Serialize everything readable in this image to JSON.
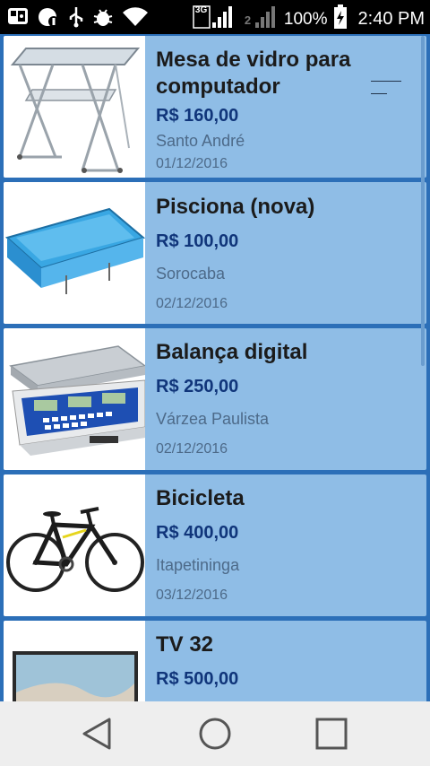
{
  "status_bar": {
    "network_label": "3G",
    "sim_label": "2",
    "battery": "100%",
    "time": "2:40 PM",
    "icons": [
      "whatsapp-icon",
      "notification-icon",
      "usb-icon",
      "bug-icon",
      "wifi-icon",
      "signal-icon",
      "signal-icon-2",
      "battery-charging-icon"
    ]
  },
  "listings": [
    {
      "title": "Mesa de vidro para computador",
      "price": "R$ 160,00",
      "city": "Santo André",
      "date": "01/12/2016",
      "image": "glass-desk"
    },
    {
      "title": "Pisciona (nova)",
      "price": "R$ 100,00",
      "city": "Sorocaba",
      "date": "02/12/2016",
      "image": "pool"
    },
    {
      "title": "Balança digital",
      "price": "R$ 250,00",
      "city": "Várzea Paulista",
      "date": "02/12/2016",
      "image": "digital-scale"
    },
    {
      "title": "Bicicleta",
      "price": "R$ 400,00",
      "city": "Itapetininga",
      "date": "03/12/2016",
      "image": "bicycle"
    },
    {
      "title": "TV 32",
      "price": "R$ 500,00",
      "city": "",
      "date": "",
      "image": "tv"
    }
  ],
  "navigation": {
    "buttons": [
      "back-icon",
      "home-icon",
      "recents-icon"
    ]
  },
  "colors": {
    "card_bg": "#8fbde6",
    "list_bg": "#2c6fb8",
    "price": "#10357a",
    "status_bar": "#000000",
    "nav_bar": "#eeeeee"
  }
}
